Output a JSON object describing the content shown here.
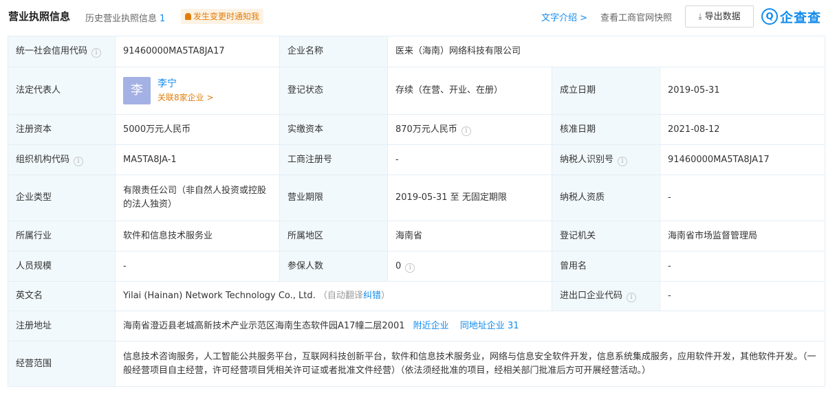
{
  "header": {
    "title": "营业执照信息",
    "history_label": "历史营业执照信息",
    "history_count": "1",
    "notify_label": "发生变更时通知我",
    "text_intro": "文字介绍 >",
    "snapshot": "查看工商官网快照",
    "export": "导出数据",
    "logo_text": "企查查"
  },
  "row1": {
    "l1": "统一社会信用代码",
    "v1": "91460000MA5TA8JA17",
    "l2": "企业名称",
    "v2": "医来（海南）网络科技有限公司"
  },
  "row2": {
    "l1": "法定代表人",
    "avatar_char": "李",
    "person_name": "李宁",
    "related": "关联8家企业 >",
    "l2": "登记状态",
    "v2": "存续（在营、开业、在册）",
    "l3": "成立日期",
    "v3": "2019-05-31"
  },
  "row3": {
    "l1": "注册资本",
    "v1": "5000万元人民币",
    "l2": "实缴资本",
    "v2": "870万元人民币",
    "l3": "核准日期",
    "v3": "2021-08-12"
  },
  "row4": {
    "l1": "组织机构代码",
    "v1": "MA5TA8JA-1",
    "l2": "工商注册号",
    "v2": "-",
    "l3": "纳税人识别号",
    "v3": "91460000MA5TA8JA17"
  },
  "row5": {
    "l1": "企业类型",
    "v1": "有限责任公司（非自然人投资或控股的法人独资）",
    "l2": "营业期限",
    "v2": "2019-05-31 至 无固定期限",
    "l3": "纳税人资质",
    "v3": "-"
  },
  "row6": {
    "l1": "所属行业",
    "v1": "软件和信息技术服务业",
    "l2": "所属地区",
    "v2": "海南省",
    "l3": "登记机关",
    "v3": "海南省市场监督管理局"
  },
  "row7": {
    "l1": "人员规模",
    "v1": "-",
    "l2": "参保人数",
    "v2": "0",
    "l3": "曾用名",
    "v3": "-"
  },
  "row8": {
    "l1": "英文名",
    "v1": "Yilai (Hainan) Network Technology Co., Ltd.",
    "auto_translate_open": "（自动翻译",
    "correct": "纠错",
    "auto_translate_close": "）",
    "l3": "进出口企业代码",
    "v3": "-"
  },
  "row9": {
    "l1": "注册地址",
    "v1": "海南省澄迈县老城高新技术产业示范区海南生态软件园A17幢二层2001",
    "nearby": "附近企业",
    "same_addr": "同地址企业 31"
  },
  "row10": {
    "l1": "经营范围",
    "v1": "信息技术咨询服务，人工智能公共服务平台，互联网科技创新平台，软件和信息技术服务业，网络与信息安全软件开发，信息系统集成服务，应用软件开发，其他软件开发。（一般经营项目自主经营，许可经营项目凭相关许可证或者批准文件经营）（依法须经批准的项目，经相关部门批准后方可开展经营活动。）"
  },
  "colors": {
    "label_bg": "#f2f9fc",
    "border": "#e4eef6",
    "link": "#128bed",
    "orange": "#e07c0b"
  },
  "icons": {
    "info": "info-circle-icon",
    "bell": "bell-icon",
    "download": "download-icon",
    "logo": "qichacha-logo-icon"
  }
}
